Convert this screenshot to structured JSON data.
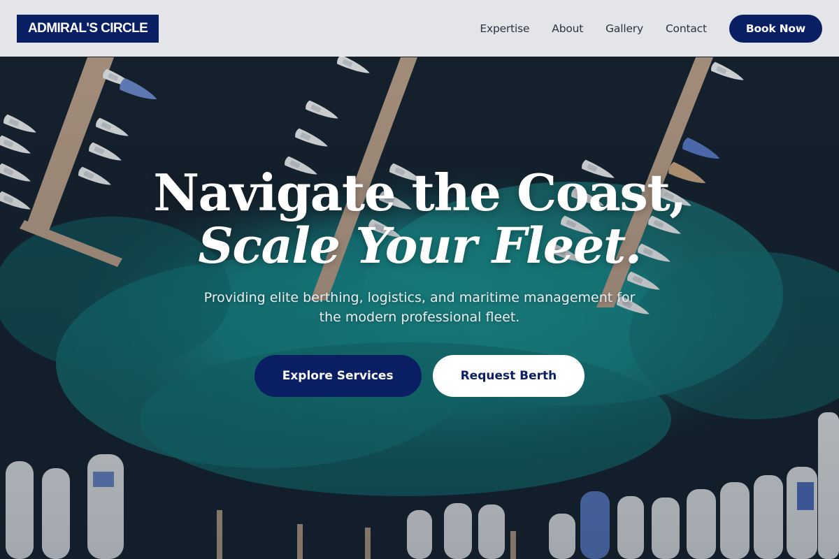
{
  "nav": {
    "logo_text": "ADMIRAL'S CIRCLE",
    "links": [
      "Expertise",
      "About",
      "Gallery",
      "Contact"
    ],
    "cta_label": "Book Now"
  },
  "hero": {
    "headline_line1": "Navigate the Coast,",
    "headline_line2": "Scale Your Fleet.",
    "subtitle": "Providing elite berthing, logistics, and maritime management for the modern professional fleet.",
    "primary_cta": "Explore Services",
    "secondary_cta": "Request Berth",
    "background_image": "aerial-marina-photo"
  },
  "colors": {
    "brand_navy": "#0a1f63",
    "nav_bg": "#f3f4f6",
    "text_white": "#ffffff",
    "water_teal": "#1a8a8a",
    "water_dark": "#14212c"
  }
}
